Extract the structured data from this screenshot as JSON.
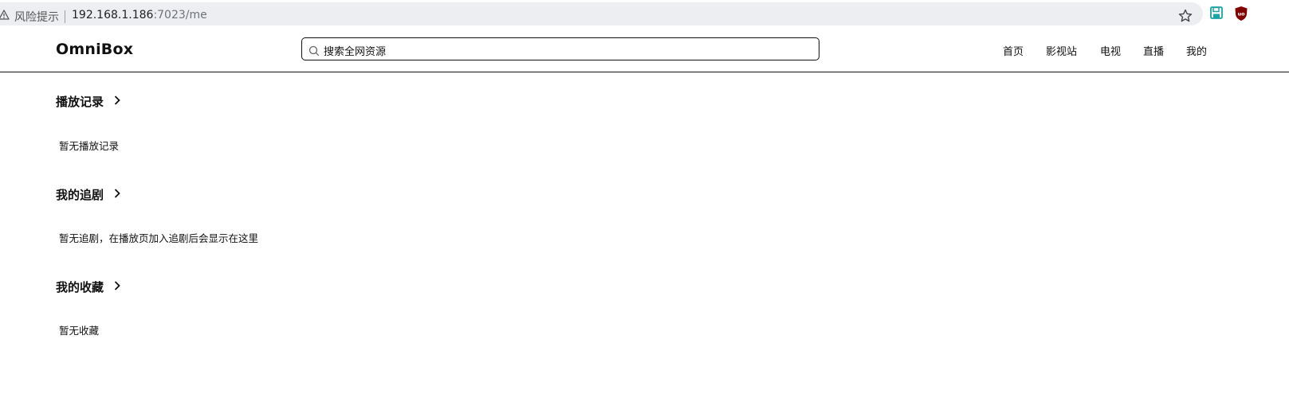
{
  "browser": {
    "risk_label": "风险提示",
    "url_host": "192.168.1.186",
    "url_rest": ":7023/me"
  },
  "header": {
    "logo": "OmniBox",
    "search_placeholder": "搜索全网资源",
    "nav": [
      "首页",
      "影视站",
      "电视",
      "直播",
      "我的"
    ]
  },
  "sections": [
    {
      "title": "播放记录",
      "empty": "暂无播放记录"
    },
    {
      "title": "我的追剧",
      "empty": "暂无追剧，在播放页加入追剧后会显示在这里"
    },
    {
      "title": "我的收藏",
      "empty": "暂无收藏"
    }
  ],
  "colors": {
    "address_bar": "#eceef2",
    "save_ext": "#1aa3a3",
    "ublock": "#800000"
  }
}
